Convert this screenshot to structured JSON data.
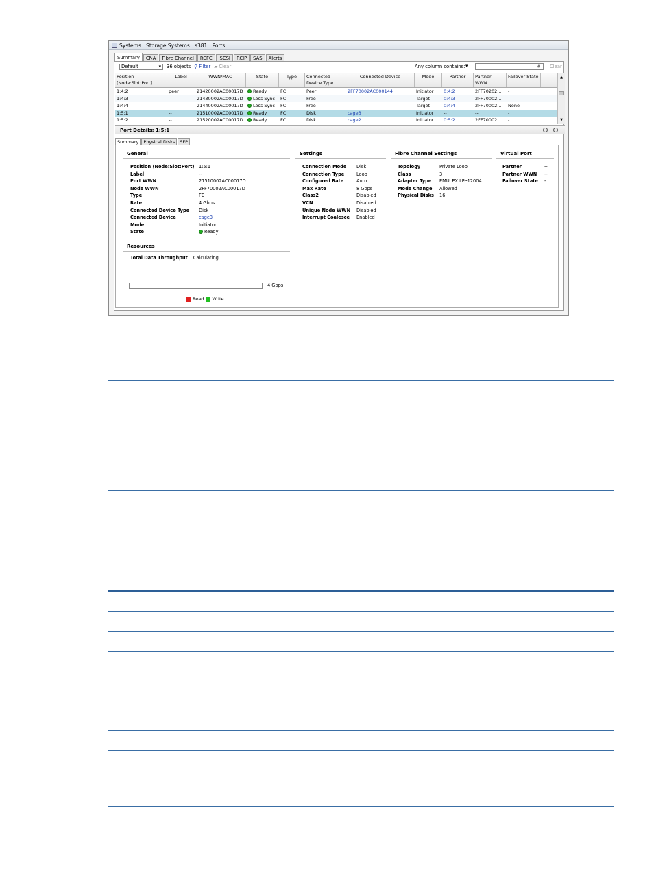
{
  "window": {
    "title": "Systems : Storage Systems : s381 : Ports",
    "tabs": [
      "Summary",
      "CNA",
      "Fibre Channel",
      "RCFC",
      "iSCSI",
      "RCIP",
      "SAS",
      "Alerts"
    ]
  },
  "toolbar": {
    "view_select": "Default",
    "object_count": "36 objects",
    "filter_label": "Filter",
    "clear_label": "Clear",
    "column_filter_label": "Any column contains:",
    "search_value": "",
    "search_clear_label": "Clear"
  },
  "grid": {
    "columns": [
      {
        "label": "Position (Node:Slot:Port)",
        "w": 76
      },
      {
        "label": "Label",
        "w": 41
      },
      {
        "label": "WWN/MAC",
        "w": 74
      },
      {
        "label": "State",
        "w": 48
      },
      {
        "label": "Type",
        "w": 38
      },
      {
        "label": "Connected Device Type",
        "w": 60
      },
      {
        "label": "Connected Device",
        "w": 100
      },
      {
        "label": "Mode",
        "w": 40
      },
      {
        "label": "Partner",
        "w": 46
      },
      {
        "label": "Partner WWN",
        "w": 48
      },
      {
        "label": "Failover State",
        "w": 50
      }
    ],
    "rows": [
      {
        "position": "1:4:2",
        "label": "peer",
        "wwn": "21420002AC00017D",
        "state": "Ready",
        "type": "FC",
        "device_type": "Peer",
        "device": "2FF70002AC000144",
        "mode": "Initiator",
        "partner": "0:4:2",
        "partner_wwn": "2FF70202...",
        "failover": "-"
      },
      {
        "position": "1:4:3",
        "label": "--",
        "wwn": "21430002AC00017D",
        "state": "Loss Sync",
        "type": "FC",
        "device_type": "Free",
        "device": "--",
        "mode": "Target",
        "partner": "0:4:3",
        "partner_wwn": "2FF70002...",
        "failover": "-"
      },
      {
        "position": "1:4:4",
        "label": "--",
        "wwn": "21440002AC00017D",
        "state": "Loss Sync",
        "type": "FC",
        "device_type": "Free",
        "device": "--",
        "mode": "Target",
        "partner": "0:4:4",
        "partner_wwn": "2FF70002...",
        "failover": "None"
      },
      {
        "position": "1:5:1",
        "label": "--",
        "wwn": "21510002AC00017D",
        "state": "Ready",
        "type": "FC",
        "device_type": "Disk",
        "device": "cage3",
        "mode": "Initiator",
        "partner": "--",
        "partner_wwn": "--",
        "failover": "-"
      },
      {
        "position": "1:5:2",
        "label": "--",
        "wwn": "21520002AC00017D",
        "state": "Ready",
        "type": "FC",
        "device_type": "Disk",
        "device": "cage2",
        "mode": "Initiator",
        "partner": "0:5:2",
        "partner_wwn": "2FF70002...",
        "failover": "-"
      }
    ],
    "selected_row": 3
  },
  "details": {
    "title": "Port Details: 1:5:1",
    "tabs": [
      "Summary",
      "Physical Disks",
      "SFP"
    ],
    "general": {
      "heading": "General",
      "items": [
        {
          "k": "Position (Node:Slot:Port)",
          "v": "1:5:1"
        },
        {
          "k": "Label",
          "v": "--"
        },
        {
          "k": "Port WWN",
          "v": "21510002AC00017D"
        },
        {
          "k": "Node WWN",
          "v": "2FF70002AC00017D"
        },
        {
          "k": "Type",
          "v": "FC"
        },
        {
          "k": "Rate",
          "v": "4 Gbps"
        },
        {
          "k": "Connected Device Type",
          "v": "Disk"
        },
        {
          "k": "Connected Device",
          "v": "cage3"
        },
        {
          "k": "Mode",
          "v": "Initiator"
        },
        {
          "k": "State",
          "v": "Ready"
        }
      ]
    },
    "settings": {
      "heading": "Settings",
      "items": [
        {
          "k": "Connection Mode",
          "v": "Disk"
        },
        {
          "k": "Connection Type",
          "v": "Loop"
        },
        {
          "k": "Configured Rate",
          "v": "Auto"
        },
        {
          "k": "Max Rate",
          "v": "8 Gbps"
        },
        {
          "k": "Class2",
          "v": "Disabled"
        },
        {
          "k": "VCN",
          "v": "Disabled"
        },
        {
          "k": "Unique Node WWN",
          "v": "Disabled"
        },
        {
          "k": "Interrupt Coalesce",
          "v": "Enabled"
        }
      ]
    },
    "fc": {
      "heading": "Fibre Channel Settings",
      "items": [
        {
          "k": "Topology",
          "v": "Private Loop"
        },
        {
          "k": "Class",
          "v": "3"
        },
        {
          "k": "Adapter Type",
          "v": "EMULEX LPe12004"
        },
        {
          "k": "Mode Change",
          "v": "Allowed"
        },
        {
          "k": "Physical Disks",
          "v": "16"
        }
      ]
    },
    "virtual": {
      "heading": "Virtual Port",
      "items": [
        {
          "k": "Partner",
          "v": "--"
        },
        {
          "k": "Partner WWN",
          "v": "--"
        },
        {
          "k": "Failover State",
          "v": "-"
        }
      ]
    },
    "resources": {
      "heading": "Resources",
      "throughput_label": "Total Data Throughput",
      "throughput_value": "Calculating...",
      "max_label": "4 Gbps",
      "legend_read": "Read",
      "legend_write": "Write"
    }
  },
  "colors": {
    "read": "#e02020",
    "write": "#22c022",
    "link": "#1a3fb0",
    "rule": "#3a6ea5"
  }
}
